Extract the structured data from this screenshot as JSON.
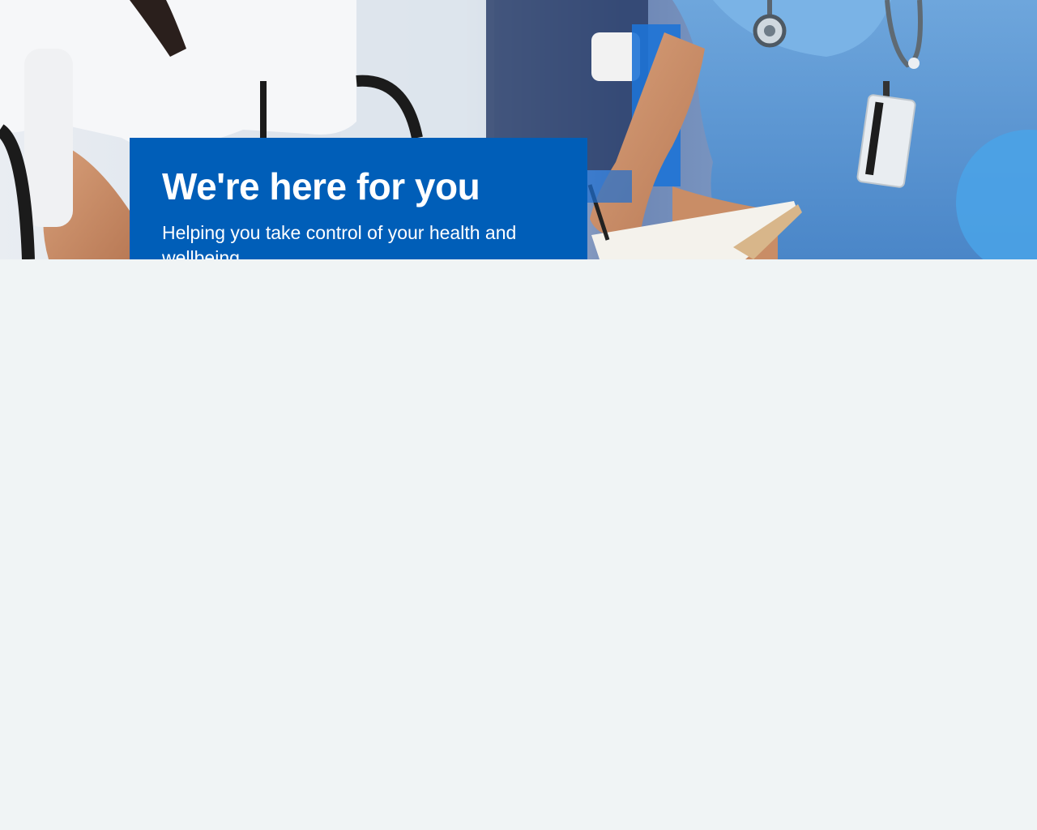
{
  "hero": {
    "image_alt": "Healthcare professional in blue scrubs with stethoscope and ID badge writing on a clipboard beside a patient",
    "title": "We're here for you",
    "subtitle": "Helping you take control of your health and wellbeing."
  },
  "colors": {
    "callout_background": "#005eb8",
    "page_background": "#f0f4f5",
    "callout_text": "#ffffff"
  }
}
